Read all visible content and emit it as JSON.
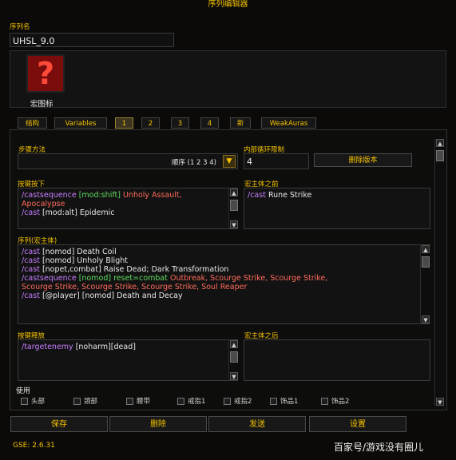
{
  "window": {
    "title": "序列编辑器"
  },
  "sequence": {
    "name_label": "序列名",
    "name_value": "UHSL_9.0",
    "icon_label": "宏图标"
  },
  "tabs": [
    "结构",
    "Variables",
    "1",
    "2",
    "3",
    "4",
    "新",
    "WeakAuras"
  ],
  "active_tab": "1",
  "step": {
    "label": "步骤方法",
    "value": "顺序 (1 2 3 4)"
  },
  "loop": {
    "label": "内部循环限制",
    "value": "4"
  },
  "delete_version": "删除版本",
  "keydown": {
    "label": "按键按下"
  },
  "prebody": {
    "label": "宏主体之前",
    "line1_cmd": "/cast",
    "line1_text": " Rune Strike"
  },
  "sequence_body": {
    "label": "序列(宏主体)"
  },
  "keyup": {
    "label": "按键释放",
    "line1_cmd": "/targetenemy",
    "line1_text": " [noharm][dead]"
  },
  "postbody": {
    "label": "宏主体之后"
  },
  "use": {
    "label": "使用",
    "items": [
      "头部",
      "颈部",
      "腰带",
      "戒指1",
      "戒指2",
      "饰品1",
      "饰品2"
    ]
  },
  "buttons": {
    "save": "保存",
    "delete": "删除",
    "send": "发送",
    "settings": "设置"
  },
  "version": "GSE: 2.6.31",
  "watermark": "百家号/游戏没有圈儿",
  "code": {
    "kd1a": "/castsequence",
    "kd1b": " [mod:shift] ",
    "kd1c": "Unholy Assault,",
    "kd2a": "Apocalypse",
    "kd3a": "/cast",
    "kd3b": " [mod:alt] Epidemic",
    "s1a": "/cast",
    "s1b": " [nomod] Death Coil",
    "s2a": "/cast",
    "s2b": " [nomod] Unholy Blight",
    "s3a": "/cast",
    "s3b": " [nopet,combat] Raise Dead; Dark Transformation",
    "s4a": "/castsequence",
    "s4b": " [nomod] reset=combat ",
    "s4c": " Outbreak, Scourge Strike, Scourge Strike,",
    "s5a": "Scourge Strike, Scourge Strike, Scourge Strike, Soul Reaper",
    "s6a": "/cast",
    "s6b": " [@player] [nomod] Death and Decay"
  }
}
